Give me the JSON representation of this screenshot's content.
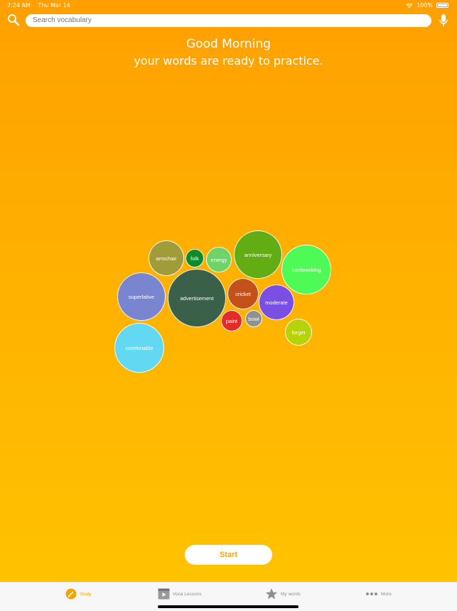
{
  "status_bar": {
    "time": "7:24 AM",
    "date": "Thu Mar 14",
    "battery": "100%"
  },
  "search": {
    "placeholder": "Search vocabulary",
    "value": ""
  },
  "greeting": {
    "title": "Good Morning",
    "subtitle": "your words are ready to practice."
  },
  "words": [
    {
      "word": "armchair",
      "color": "#a09c3a"
    },
    {
      "word": "folk",
      "color": "#0d8a2b"
    },
    {
      "word": "energy",
      "color": "#6fd36a"
    },
    {
      "word": "anniversary",
      "color": "#62ad13"
    },
    {
      "word": "hardworking",
      "color": "#4dfa56"
    },
    {
      "word": "superlative",
      "color": "#7a85cf"
    },
    {
      "word": "advertisement",
      "color": "#3a604a"
    },
    {
      "word": "cricket",
      "color": "#c4511a"
    },
    {
      "word": "moderate",
      "color": "#7b4fe4"
    },
    {
      "word": "paint",
      "color": "#e42a2a"
    },
    {
      "word": "bowl",
      "color": "#8c9290"
    },
    {
      "word": "forget",
      "color": "#b6d30a"
    },
    {
      "word": "comfortable",
      "color": "#62d8f2"
    }
  ],
  "actions": {
    "start_label": "Start"
  },
  "tabs": [
    {
      "label": "Study",
      "icon": "study-icon",
      "active": true
    },
    {
      "label": "Voca Lessons",
      "icon": "play-lessons-icon",
      "active": false
    },
    {
      "label": "My words",
      "icon": "star-icon",
      "active": false
    },
    {
      "label": "More",
      "icon": "more-dots-icon",
      "active": false
    }
  ],
  "colors": {
    "accent": "#f5a300",
    "background_top": "#ffa000",
    "background_bottom": "#ffc400"
  }
}
